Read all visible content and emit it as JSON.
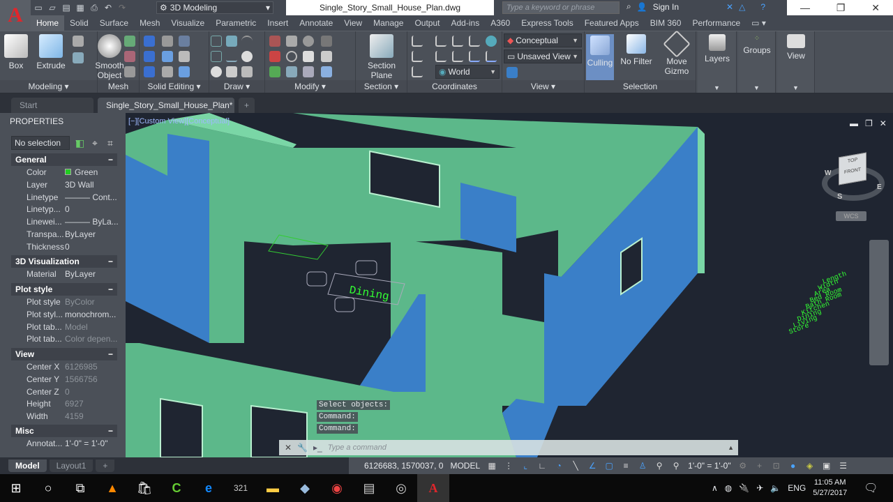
{
  "titlebar": {
    "workspace": "3D Modeling",
    "document_title": "Single_Story_Small_House_Plan.dwg",
    "search_placeholder": "Type a keyword or phrase",
    "sign_in": "Sign In"
  },
  "ribbon_tabs": [
    "Home",
    "Solid",
    "Surface",
    "Mesh",
    "Visualize",
    "Parametric",
    "Insert",
    "Annotate",
    "View",
    "Manage",
    "Output",
    "Add-ins",
    "A360",
    "Express Tools",
    "Featured Apps",
    "BIM 360",
    "Performance"
  ],
  "ribbon": {
    "panels": {
      "modeling": "Modeling",
      "mesh": "Mesh",
      "solid_editing": "Solid Editing",
      "draw": "Draw",
      "modify": "Modify",
      "section": "Section",
      "coordinates": "Coordinates",
      "view": "View",
      "selection": "Selection"
    },
    "buttons": {
      "box": "Box",
      "extrude": "Extrude",
      "smooth_object_1": "Smooth",
      "smooth_object_2": "Object",
      "section_plane_1": "Section",
      "section_plane_2": "Plane",
      "culling": "Culling",
      "no_filter": "No Filter",
      "move_gizmo_1": "Move",
      "move_gizmo_2": "Gizmo",
      "layers": "Layers",
      "groups": "Groups",
      "view": "View"
    },
    "visual_style": "Conceptual",
    "named_view": "Unsaved View",
    "ucs": "World"
  },
  "file_tabs": [
    "Start",
    "Single_Story_Small_House_Plan*"
  ],
  "properties": {
    "title": "PROPERTIES",
    "selection": "No selection",
    "sections": {
      "general": {
        "title": "General",
        "rows": [
          {
            "k": "Color",
            "v": "Green"
          },
          {
            "k": "Layer",
            "v": "3D Wall"
          },
          {
            "k": "Linetype",
            "v": "——— Cont..."
          },
          {
            "k": "Linetyp...",
            "v": "0"
          },
          {
            "k": "Linewei...",
            "v": "——— ByLa..."
          },
          {
            "k": "Transpa...",
            "v": "ByLayer"
          },
          {
            "k": "Thickness",
            "v": "0"
          }
        ]
      },
      "viz": {
        "title": "3D Visualization",
        "rows": [
          {
            "k": "Material",
            "v": "ByLayer"
          }
        ]
      },
      "plot": {
        "title": "Plot style",
        "rows": [
          {
            "k": "Plot style",
            "v": "ByColor"
          },
          {
            "k": "Plot styl...",
            "v": "monochrom..."
          },
          {
            "k": "Plot tab...",
            "v": "Model"
          },
          {
            "k": "Plot tab...",
            "v": "Color depen..."
          }
        ]
      },
      "view": {
        "title": "View",
        "rows": [
          {
            "k": "Center X",
            "v": "6126985"
          },
          {
            "k": "Center Y",
            "v": "1566756"
          },
          {
            "k": "Center Z",
            "v": "0"
          },
          {
            "k": "Height",
            "v": "6927"
          },
          {
            "k": "Width",
            "v": "4159"
          }
        ]
      },
      "misc": {
        "title": "Misc",
        "rows": [
          {
            "k": "Annotat...",
            "v": "1'-0\" = 1'-0\""
          }
        ]
      }
    }
  },
  "viewport": {
    "label": "[−][Custom View][Conceptual]",
    "viewcube": {
      "top": "TOP",
      "front": "FRONT",
      "w": "W",
      "e": "E",
      "s": "S",
      "wcs": "WCS"
    },
    "room_label": "Dining",
    "schedule": [
      "Length",
      "Width",
      "Area",
      "Bed Room",
      "Bath Room",
      "Kitchen",
      "Dining",
      "Living",
      "Store"
    ]
  },
  "command": {
    "history": [
      "Select objects:",
      "Command:",
      "Command:"
    ],
    "placeholder": "Type a command"
  },
  "layout_tabs": [
    "Model",
    "Layout1"
  ],
  "status": {
    "coords": "6126683, 1570037, 0",
    "space": "MODEL",
    "scale": "1'-0\" = 1'-0\""
  },
  "taskbar": {
    "time": "11:05 AM",
    "date": "5/27/2017",
    "lang": "ENG"
  },
  "colors": {
    "wall_green": "#5cb88a",
    "wall_blue": "#3a7fc8",
    "accent_red": "#e0262b"
  }
}
